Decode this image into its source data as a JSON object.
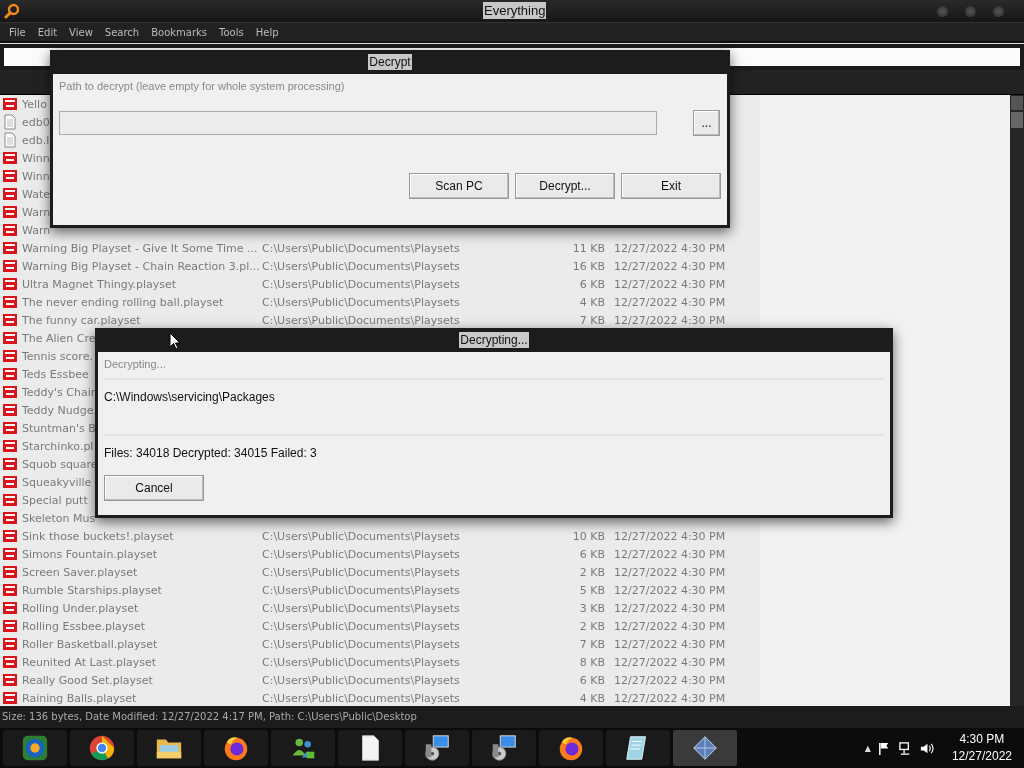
{
  "window": {
    "title": "Everything"
  },
  "menu": [
    "File",
    "Edit",
    "View",
    "Search",
    "Bookmarks",
    "Tools",
    "Help"
  ],
  "file_list": {
    "rows": [
      {
        "kind": "playset",
        "name": "Yello"
      },
      {
        "kind": "document",
        "name": "edb0"
      },
      {
        "kind": "document",
        "name": "edb.l"
      },
      {
        "kind": "playset",
        "name": "Winn"
      },
      {
        "kind": "playset",
        "name": "Winn"
      },
      {
        "kind": "playset",
        "name": "Wate"
      },
      {
        "kind": "playset",
        "name": "Warn"
      },
      {
        "kind": "playset",
        "name": "Warn"
      },
      {
        "kind": "playset",
        "name": "Warning Big Playset - Give It Some Time ...",
        "path": "C:\\Users\\Public\\Documents\\Playsets",
        "size": "11 KB",
        "modified": "12/27/2022 4:30 PM"
      },
      {
        "kind": "playset",
        "name": "Warning Big Playset - Chain Reaction 3.pl...",
        "path": "C:\\Users\\Public\\Documents\\Playsets",
        "size": "16 KB",
        "modified": "12/27/2022 4:30 PM"
      },
      {
        "kind": "playset",
        "name": "Ultra Magnet Thingy.playset",
        "path": "C:\\Users\\Public\\Documents\\Playsets",
        "size": "6 KB",
        "modified": "12/27/2022 4:30 PM"
      },
      {
        "kind": "playset",
        "name": "The never ending rolling ball.playset",
        "path": "C:\\Users\\Public\\Documents\\Playsets",
        "size": "4 KB",
        "modified": "12/27/2022 4:30 PM"
      },
      {
        "kind": "playset",
        "name": "The funny car.playset",
        "path": "C:\\Users\\Public\\Documents\\Playsets",
        "size": "7 KB",
        "modified": "12/27/2022 4:30 PM"
      },
      {
        "kind": "playset",
        "name": "The Alien Cre"
      },
      {
        "kind": "playset",
        "name": "Tennis score."
      },
      {
        "kind": "playset",
        "name": "Teds Essbee"
      },
      {
        "kind": "playset",
        "name": "Teddy's Chain"
      },
      {
        "kind": "playset",
        "name": "Teddy Nudge."
      },
      {
        "kind": "playset",
        "name": "Stuntman's B"
      },
      {
        "kind": "playset",
        "name": "Starchinko.pl"
      },
      {
        "kind": "playset",
        "name": "Squob square"
      },
      {
        "kind": "playset",
        "name": "Squeakyville"
      },
      {
        "kind": "playset",
        "name": "Special putt"
      },
      {
        "kind": "playset",
        "name": "Skeleton Mus"
      },
      {
        "kind": "playset",
        "name": "Sink those buckets!.playset",
        "path": "C:\\Users\\Public\\Documents\\Playsets",
        "size": "10 KB",
        "modified": "12/27/2022 4:30 PM"
      },
      {
        "kind": "playset",
        "name": "Simons Fountain.playset",
        "path": "C:\\Users\\Public\\Documents\\Playsets",
        "size": "6 KB",
        "modified": "12/27/2022 4:30 PM"
      },
      {
        "kind": "playset",
        "name": "Screen Saver.playset",
        "path": "C:\\Users\\Public\\Documents\\Playsets",
        "size": "2 KB",
        "modified": "12/27/2022 4:30 PM"
      },
      {
        "kind": "playset",
        "name": "Rumble Starships.playset",
        "path": "C:\\Users\\Public\\Documents\\Playsets",
        "size": "5 KB",
        "modified": "12/27/2022 4:30 PM"
      },
      {
        "kind": "playset",
        "name": "Rolling Under.playset",
        "path": "C:\\Users\\Public\\Documents\\Playsets",
        "size": "3 KB",
        "modified": "12/27/2022 4:30 PM"
      },
      {
        "kind": "playset",
        "name": "Rolling Essbee.playset",
        "path": "C:\\Users\\Public\\Documents\\Playsets",
        "size": "2 KB",
        "modified": "12/27/2022 4:30 PM"
      },
      {
        "kind": "playset",
        "name": "Roller Basketball.playset",
        "path": "C:\\Users\\Public\\Documents\\Playsets",
        "size": "7 KB",
        "modified": "12/27/2022 4:30 PM"
      },
      {
        "kind": "playset",
        "name": "Reunited At Last.playset",
        "path": "C:\\Users\\Public\\Documents\\Playsets",
        "size": "8 KB",
        "modified": "12/27/2022 4:30 PM"
      },
      {
        "kind": "playset",
        "name": "Really Good Set.playset",
        "path": "C:\\Users\\Public\\Documents\\Playsets",
        "size": "6 KB",
        "modified": "12/27/2022 4:30 PM"
      },
      {
        "kind": "playset",
        "name": "Raining Balls.playset",
        "path": "C:\\Users\\Public\\Documents\\Playsets",
        "size": "4 KB",
        "modified": "12/27/2022 4:30 PM"
      }
    ]
  },
  "status_bar": "Size: 136 bytes, Date Modified: 12/27/2022 4:17 PM, Path: C:\\Users\\Public\\Desktop",
  "decrypt_dialog": {
    "title": "Decrypt",
    "label": "Path to decrypt (leave empty for whole system processing)",
    "browse_button": "...",
    "buttons": [
      "Scan PC",
      "Decrypt...",
      "Exit"
    ]
  },
  "progress_dialog": {
    "title": "Decrypting...",
    "status": "Decrypting...",
    "current_path": "C:\\Windows\\servicing\\Packages",
    "counts": "Files: 34018 Decrypted: 34015 Failed: 3",
    "cancel_button": "Cancel"
  },
  "taskbar": {
    "apps": [
      {
        "kind": "chromium"
      },
      {
        "kind": "chrome"
      },
      {
        "kind": "folder"
      },
      {
        "kind": "firefox"
      },
      {
        "kind": "people"
      },
      {
        "kind": "document"
      },
      {
        "kind": "installer"
      },
      {
        "kind": "installer"
      },
      {
        "kind": "firefox"
      },
      {
        "kind": "notepad"
      },
      {
        "kind": "diamond"
      }
    ],
    "tray_arrow": "▲",
    "time": "4:30 PM",
    "date": "12/27/2022"
  }
}
